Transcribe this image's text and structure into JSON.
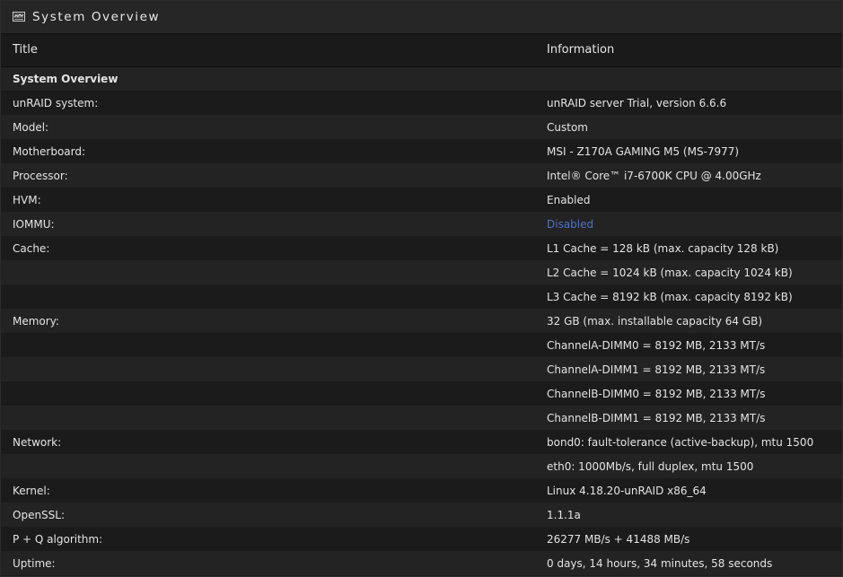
{
  "panel": {
    "title": "System Overview",
    "icon": "monitor-chart-icon"
  },
  "table": {
    "headers": [
      "Title",
      "Information"
    ],
    "rows": [
      {
        "title": "System Overview",
        "info": "",
        "section": true
      },
      {
        "title": "unRAID system:",
        "info": "unRAID server Trial, version 6.6.6"
      },
      {
        "title": "Model:",
        "info": "Custom"
      },
      {
        "title": "Motherboard:",
        "info": "MSI - Z170A GAMING M5 (MS-7977)"
      },
      {
        "title": "Processor:",
        "info": "Intel® Core™ i7-6700K CPU @ 4.00GHz"
      },
      {
        "title": "HVM:",
        "info": "Enabled"
      },
      {
        "title": "IOMMU:",
        "info": "Disabled",
        "link": true
      },
      {
        "title": "Cache:",
        "info": "L1 Cache = 128 kB (max. capacity 128 kB)"
      },
      {
        "title": "",
        "info": "L2 Cache = 1024 kB (max. capacity 1024 kB)"
      },
      {
        "title": "",
        "info": "L3 Cache = 8192 kB (max. capacity 8192 kB)"
      },
      {
        "title": "Memory:",
        "info": "32 GB (max. installable capacity 64 GB)"
      },
      {
        "title": "",
        "info": "ChannelA-DIMM0 = 8192 MB, 2133 MT/s"
      },
      {
        "title": "",
        "info": "ChannelA-DIMM1 = 8192 MB, 2133 MT/s"
      },
      {
        "title": "",
        "info": "ChannelB-DIMM0 = 8192 MB, 2133 MT/s"
      },
      {
        "title": "",
        "info": "ChannelB-DIMM1 = 8192 MB, 2133 MT/s"
      },
      {
        "title": "Network:",
        "info": "bond0: fault-tolerance (active-backup), mtu 1500"
      },
      {
        "title": "",
        "info": "eth0: 1000Mb/s, full duplex, mtu 1500"
      },
      {
        "title": "Kernel:",
        "info": "Linux 4.18.20-unRAID x86_64"
      },
      {
        "title": "OpenSSL:",
        "info": "1.1.1a"
      },
      {
        "title": "P + Q algorithm:",
        "info": "26277 MB/s + 41488 MB/s"
      },
      {
        "title": "Uptime:",
        "info": "0 days, 14 hours, 34 minutes, 58 seconds"
      }
    ]
  },
  "colors": {
    "link": "#4a74c9",
    "background": "#1c1c1c",
    "row_odd": "#232323",
    "row_even": "#1b1b1b"
  }
}
